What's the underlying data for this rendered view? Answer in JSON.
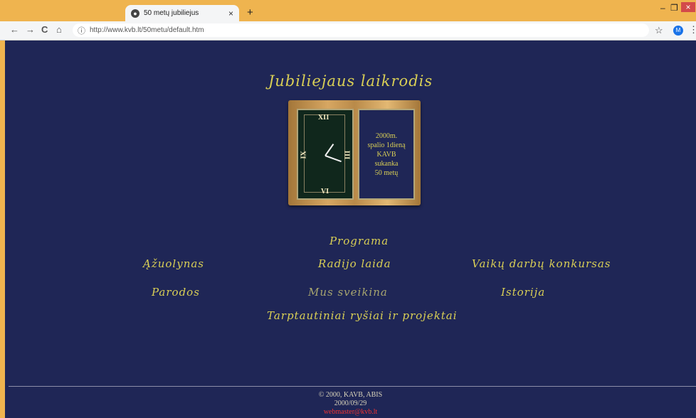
{
  "browser": {
    "tab_title": "50 metų jubiliejus",
    "tab_close": "×",
    "new_tab": "+",
    "url": "http://www.kvb.lt/50metu/default.htm",
    "profile_initial": "M",
    "window_min": "–",
    "window_restore": "❐",
    "window_close": "×",
    "nav_back": "←",
    "nav_forward": "→",
    "nav_reload": "C",
    "nav_home": "⌂",
    "info_icon": "ⓘ",
    "star_icon": "☆",
    "menu_icon": "⋮"
  },
  "page": {
    "heading": "Jubiliejaus laikrodis",
    "clock_numerals": [
      "XII",
      "III",
      "VI",
      "IX"
    ],
    "book_text": [
      "2000m.",
      "spalio 1dieną",
      "KAVB",
      "sukanka",
      "50 metų"
    ],
    "links": {
      "programa": "Programa",
      "azuolynas": "Ąžuolynas",
      "radijo_laida": "Radijo laida",
      "vaiku_darbu": "Vaikų darbų konkursas",
      "parodos": "Parodos",
      "mus_sveikina": "Mus sveikina",
      "istorija": "Istorija",
      "tarptautiniai": "Tarptautiniai ryšiai ir projektai"
    },
    "footer": {
      "copyright": "© 2000, KAVB, ABIS",
      "date": "2000/09/29",
      "email": "webmaster@kvb.lt"
    }
  },
  "colors": {
    "page_bg": "#1f2656",
    "link_gold": "#d9cf55",
    "link_visited": "#a7a56f",
    "chrome_tabbar": "#efb44f",
    "email_red": "#e33333"
  }
}
